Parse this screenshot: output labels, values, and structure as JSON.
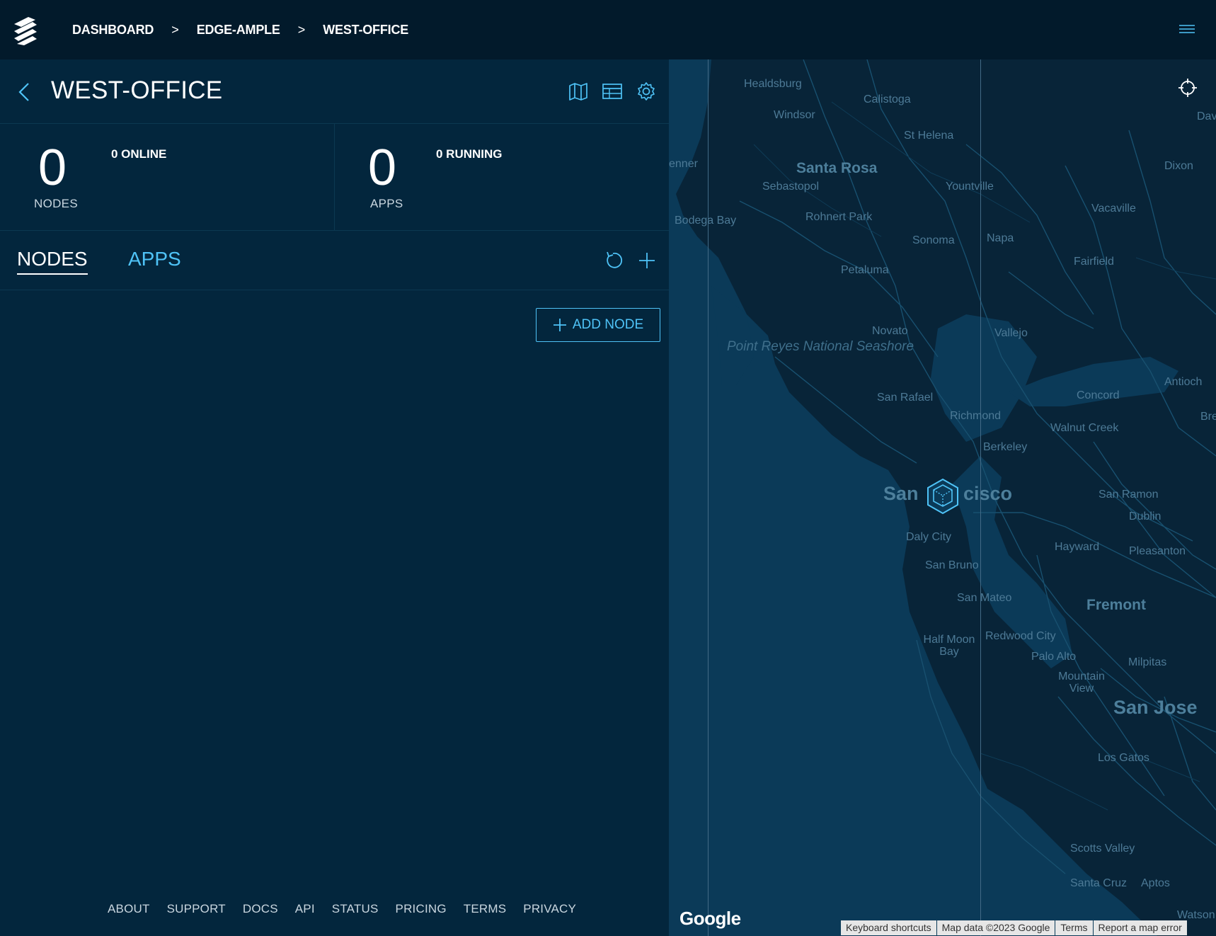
{
  "breadcrumb": [
    "DASHBOARD",
    "EDGE-AMPLE",
    "WEST-OFFICE"
  ],
  "breadcrumb_separator": ">",
  "title": "WEST-OFFICE",
  "stats": {
    "nodes": {
      "count": "0",
      "label": "NODES",
      "sub": "0  ONLINE"
    },
    "apps": {
      "count": "0",
      "label": "APPS",
      "sub": "0  RUNNING"
    }
  },
  "tabs": {
    "nodes": "NODES",
    "apps": "APPS"
  },
  "add_node_label": "ADD NODE",
  "footer": [
    "ABOUT",
    "SUPPORT",
    "DOCS",
    "API",
    "STATUS",
    "PRICING",
    "TERMS",
    "PRIVACY"
  ],
  "map": {
    "labels": {
      "healdsburg": "Healdsburg",
      "calistoga": "Calistoga",
      "windsor": "Windsor",
      "st_helena": "St Helena",
      "davis": "Dav",
      "santa_rosa": "Santa Rosa",
      "dixon": "Dixon",
      "jenner": "enner",
      "sebastopol": "Sebastopol",
      "yountville": "Yountville",
      "vacaville": "Vacaville",
      "rohnert_park": "Rohnert Park",
      "bodega_bay": "Bodega Bay",
      "sonoma": "Sonoma",
      "napa": "Napa",
      "fairfield": "Fairfield",
      "petaluma": "Petaluma",
      "novato": "Novato",
      "vallejo": "Vallejo",
      "point_reyes": "Point Reyes National Seashore",
      "antioch": "Antioch",
      "concord": "Concord",
      "san_rafael": "San Rafael",
      "richmond": "Richmond",
      "walnut_creek": "Walnut Creek",
      "brentwood": "Bre",
      "berkeley": "Berkeley",
      "san_francisco_a": "San",
      "san_francisco_b": "cisco",
      "san_ramon": "San Ramon",
      "dublin": "Dublin",
      "daly_city": "Daly City",
      "hayward": "Hayward",
      "pleasanton": "Pleasanton",
      "san_bruno": "San Bruno",
      "san_mateo": "San Mateo",
      "fremont": "Fremont",
      "redwood_city": "Redwood City",
      "half_moon_bay": "Half Moon Bay",
      "palo_alto": "Palo Alto",
      "milpitas": "Milpitas",
      "mountain_view": "Mountain View",
      "san_jose": "San Jose",
      "los_gatos": "Los Gatos",
      "scotts_valley": "Scotts Valley",
      "santa_cruz": "Santa Cruz",
      "aptos": "Aptos",
      "watsonville": "Watson"
    },
    "google_logo": "Google",
    "attribution": [
      "Keyboard shortcuts",
      "Map data ©2023 Google",
      "Terms",
      "Report a map error"
    ]
  },
  "colors": {
    "topbar": "#021a2b",
    "panel": "#03263d",
    "accent": "#4fc3f7",
    "map_water": "#0b3a58",
    "map_land": "#082438"
  }
}
